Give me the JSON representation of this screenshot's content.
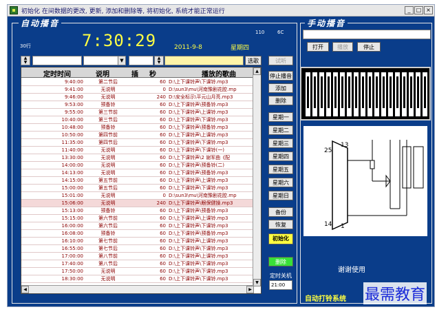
{
  "window": {
    "title": "初始化 在间数据的更改, 更新, 添加和删除等, 将初始化, 系统才能正常运行",
    "min_label": "_",
    "max_label": "□",
    "close_label": "×"
  },
  "auto": {
    "group_title": "自动播音",
    "rows_label": "30行",
    "num_a": "110",
    "num_b": "6C",
    "clock": "7:30:29",
    "date": "2011-9-8",
    "weekday": "星期四",
    "select_song_label": "选歌",
    "preview_label": "试听",
    "columns": [
      "定时时间",
      "说明",
      "插",
      "秒",
      "播放的歌曲"
    ],
    "rows": [
      {
        "time": "9:40:00",
        "desc": "第二节后",
        "sec": "60",
        "song": "D:\\上下课铃声\\下课铃.mp3"
      },
      {
        "time": "9:41:00",
        "desc": "无说明",
        "sec": "0",
        "song": "D:\\sun3\\mu\\河南豫剧花腔.mp"
      },
      {
        "time": "9:46:00",
        "desc": "无说明",
        "sec": "240",
        "song": "D:\\安全标示\\平元山月亮.mp3"
      },
      {
        "time": "9:53:00",
        "desc": "预备铃",
        "sec": "60",
        "song": "D:\\上下课铃声\\预备铃.mp3"
      },
      {
        "time": "9:55:00",
        "desc": "第三节前",
        "sec": "60",
        "song": "D:\\上下课铃声\\上课铃.mp3"
      },
      {
        "time": "10:40:00",
        "desc": "第三节后",
        "sec": "60",
        "song": "D:\\上下课铃声\\下课铃.mp3"
      },
      {
        "time": "10:48:00",
        "desc": "预备铃",
        "sec": "60",
        "song": "D:\\上下课铃声\\预备铃.mp3"
      },
      {
        "time": "10:50:00",
        "desc": "第四节前",
        "sec": "60",
        "song": "D:\\上下课铃声\\上课铃.mp3"
      },
      {
        "time": "11:35:00",
        "desc": "第四节后",
        "sec": "60",
        "song": "D:\\上下课铃声\\下课铃.mp3"
      },
      {
        "time": "11:40:00",
        "desc": "无说明",
        "sec": "60",
        "song": "D:\\上下课铃声\\下课铃(一)"
      },
      {
        "time": "13:30:00",
        "desc": "无说明",
        "sec": "60",
        "song": "D:\\上下课铃声\\2 谢军曲《配"
      },
      {
        "time": "14:00:00",
        "desc": "无说明",
        "sec": "60",
        "song": "D:\\上下课铃声\\预备铃(二)"
      },
      {
        "time": "14:13:00",
        "desc": "无说明",
        "sec": "60",
        "song": "D:\\上下课铃声\\预备铃.mp3"
      },
      {
        "time": "14:15:00",
        "desc": "第五节前",
        "sec": "60",
        "song": "D:\\上下课铃声\\上课铃.mp3"
      },
      {
        "time": "15:00:00",
        "desc": "第五节后",
        "sec": "60",
        "song": "D:\\上下课铃声\\下课铃.mp3"
      },
      {
        "time": "15:01:00",
        "desc": "无说明",
        "sec": "0",
        "song": "D:\\sun3\\mu\\河南豫剧花腔.mp"
      },
      {
        "time": "15:06:00",
        "desc": "无说明",
        "sec": "240",
        "song": "D:\\上下课铃声\\眼保健操.mp3"
      },
      {
        "time": "15:13:00",
        "desc": "预备铃",
        "sec": "60",
        "song": "D:\\上下课铃声\\预备铃.mp3"
      },
      {
        "time": "15:15:00",
        "desc": "第六节前",
        "sec": "60",
        "song": "D:\\上下课铃声\\上课铃.mp3"
      },
      {
        "time": "16:00:00",
        "desc": "第六节后",
        "sec": "60",
        "song": "D:\\上下课铃声\\下课铃.mp3"
      },
      {
        "time": "16:08:00",
        "desc": "预备铃",
        "sec": "60",
        "song": "D:\\上下课铃声\\预备铃.mp3"
      },
      {
        "time": "16:10:00",
        "desc": "第七节前",
        "sec": "60",
        "song": "D:\\上下课铃声\\上课铃.mp3"
      },
      {
        "time": "16:55:00",
        "desc": "第七节后",
        "sec": "60",
        "song": "D:\\上下课铃声\\下课铃.mp3"
      },
      {
        "time": "17:00:00",
        "desc": "第八节前",
        "sec": "60",
        "song": "D:\\上下课铃声\\上课铃.mp3"
      },
      {
        "time": "17:40:00",
        "desc": "第八节后",
        "sec": "60",
        "song": "D:\\上下课铃声\\下课铃.mp3"
      },
      {
        "time": "17:50:00",
        "desc": "无说明",
        "sec": "60",
        "song": "D:\\上下课铃声\\下课铃.mp3"
      },
      {
        "time": "18:30:00",
        "desc": "无说明",
        "sec": "60",
        "song": "D:\\上下课铃声\\下课铃.mp3"
      }
    ],
    "buttons": {
      "stop_play": "停止播音",
      "add": "添加",
      "delete": "删除",
      "backup": "备份",
      "restore": "恢复",
      "init": "初始化",
      "green": "删除"
    },
    "weekdays": [
      "星期一",
      "星期二",
      "星期三",
      "星期四",
      "星期五",
      "星期六",
      "星期日"
    ],
    "shutdown_label": "定时关机",
    "shutdown_time": "21:00"
  },
  "manual": {
    "group_title": "手动播音",
    "open_label": "打开",
    "play_label": "播放",
    "stop_label": "停止",
    "thanks": "谢谢使用",
    "status": "自动打铃系统"
  },
  "watermark": "最需教育",
  "colors": {
    "background": "#0a3d8a",
    "clock": "#ffff44",
    "table_text": "#8b0000",
    "init_button": "#ffff40",
    "green_button": "#38e038"
  }
}
